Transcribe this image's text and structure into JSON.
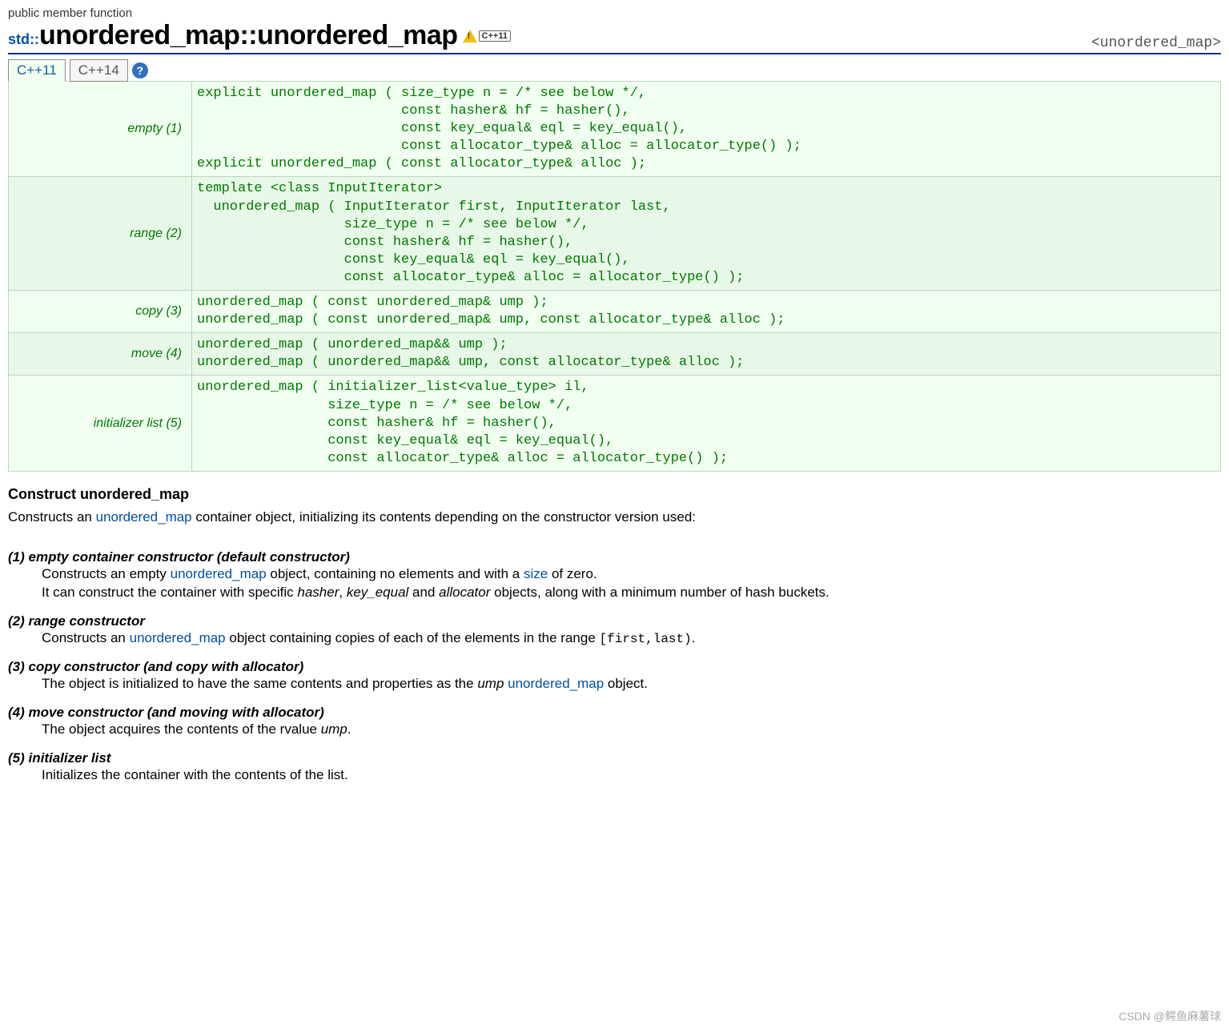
{
  "header": {
    "subtitle": "public member function",
    "namespace": "std::",
    "classname": "unordered_map",
    "sep": "::",
    "member": "unordered_map",
    "cpp_badge": "C++11",
    "include": "<unordered_map>"
  },
  "tabs": {
    "active": "C++11",
    "inactive": "C++14",
    "help": "?"
  },
  "prototypes": [
    {
      "label": "empty (1)",
      "code": "explicit unordered_map ( size_type n = /* see below */,\n                         const hasher& hf = hasher(),\n                         const key_equal& eql = key_equal(),\n                         const allocator_type& alloc = allocator_type() );\nexplicit unordered_map ( const allocator_type& alloc );"
    },
    {
      "label": "range (2)",
      "code": "template <class InputIterator>\n  unordered_map ( InputIterator first, InputIterator last,\n                  size_type n = /* see below */,\n                  const hasher& hf = hasher(),\n                  const key_equal& eql = key_equal(),\n                  const allocator_type& alloc = allocator_type() );"
    },
    {
      "label": "copy (3)",
      "code": "unordered_map ( const unordered_map& ump );\nunordered_map ( const unordered_map& ump, const allocator_type& alloc );"
    },
    {
      "label": "move (4)",
      "code": "unordered_map ( unordered_map&& ump );\nunordered_map ( unordered_map&& ump, const allocator_type& alloc );"
    },
    {
      "label": "initializer list (5)",
      "code": "unordered_map ( initializer_list<value_type> il,\n                size_type n = /* see below */,\n                const hasher& hf = hasher(),\n                const key_equal& eql = key_equal(),\n                const allocator_type& alloc = allocator_type() );"
    }
  ],
  "section_title": "Construct unordered_map",
  "intro": {
    "pre": "Constructs an ",
    "link": "unordered_map",
    "post": " container object, initializing its contents depending on the constructor version used:"
  },
  "constructors": {
    "c1": {
      "title": "(1) empty container constructor (default constructor)",
      "t1": "Constructs an empty ",
      "link1": "unordered_map",
      "t2": " object, containing no elements and with a ",
      "link2": "size",
      "t3": " of zero.",
      "t4": "It can construct the container with specific ",
      "em1": "hasher",
      "t5": ", ",
      "em2": "key_equal",
      "t6": " and ",
      "em3": "allocator",
      "t7": " objects, along with a minimum number of hash buckets."
    },
    "c2": {
      "title": "(2) range constructor",
      "t1": "Constructs an ",
      "link1": "unordered_map",
      "t2": " object containing copies of each of the elements in the range ",
      "code1": "[first,last)",
      "t3": "."
    },
    "c3": {
      "title": "(3) copy constructor (and copy with allocator)",
      "t1": "The object is initialized to have the same contents and properties as the ",
      "em1": "ump",
      "t2": " ",
      "link1": "unordered_map",
      "t3": " object."
    },
    "c4": {
      "title": "(4) move constructor (and moving with allocator)",
      "t1": "The object acquires the contents of the rvalue ",
      "em1": "ump",
      "t2": "."
    },
    "c5": {
      "title": "(5) initializer list",
      "t1": "Initializes the container with the contents of the list."
    }
  },
  "watermark": "CSDN @鳄鱼麻薯球"
}
